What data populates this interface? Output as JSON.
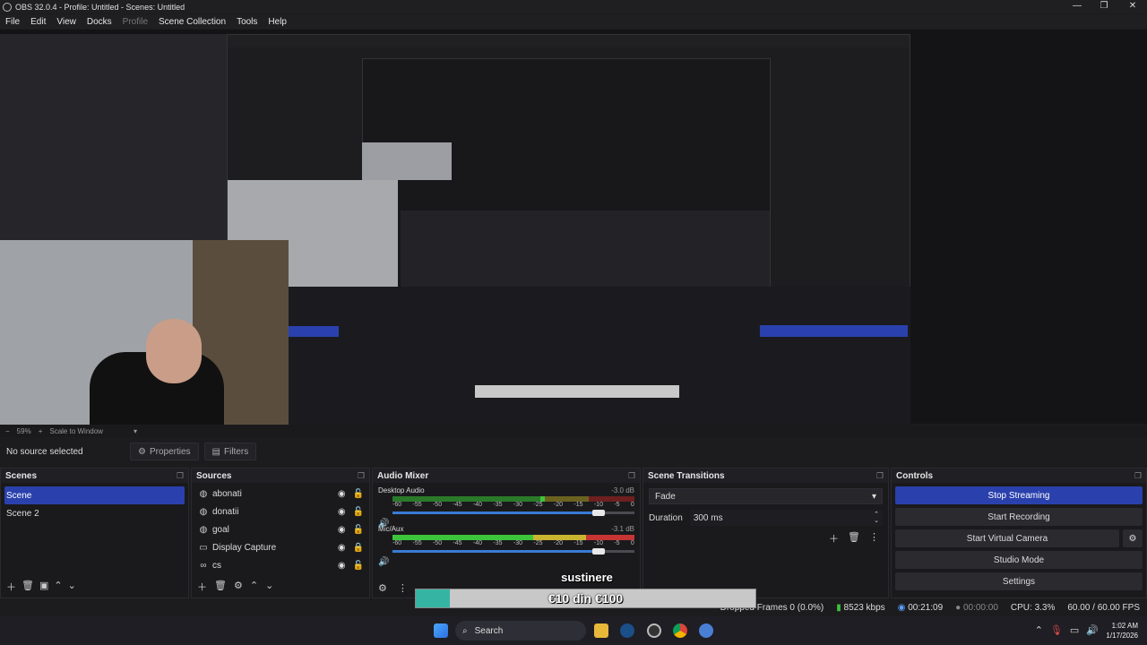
{
  "window": {
    "title": "OBS 32.0.4 - Profile: Untitled - Scenes: Untitled",
    "controls": [
      "—",
      "❐",
      "✕"
    ]
  },
  "menu": [
    "File",
    "Edit",
    "View",
    "Docks",
    "Profile",
    "Scene Collection",
    "Tools",
    "Help"
  ],
  "zoom": {
    "minus": "−",
    "value": "59%",
    "plus": "+",
    "mode": "Scale to Window"
  },
  "properties_bar": {
    "no_source": "No source selected",
    "properties": "Properties",
    "filters": "Filters"
  },
  "scenes": {
    "title": "Scenes",
    "items": [
      {
        "label": "Scene",
        "selected": true
      },
      {
        "label": "Scene 2",
        "selected": false
      }
    ]
  },
  "sources": {
    "title": "Sources",
    "items": [
      {
        "label": "abonati",
        "icon": "globe-icon",
        "locked": false
      },
      {
        "label": "donatii",
        "icon": "globe-icon",
        "locked": false
      },
      {
        "label": "goal",
        "icon": "globe-icon",
        "locked": false
      },
      {
        "label": "Display Capture",
        "icon": "monitor-icon",
        "locked": true
      },
      {
        "label": "cs",
        "icon": "link-icon",
        "locked": false
      }
    ]
  },
  "audio_mixer": {
    "title": "Audio Mixer",
    "channels": [
      {
        "name": "Desktop Audio",
        "db": "-3.0 dB",
        "volume_fraction": 0.85
      },
      {
        "name": "Mic/Aux",
        "db": "-3.1 dB",
        "volume_fraction": 0.85
      }
    ],
    "ticks": [
      "-60",
      "-55",
      "-50",
      "-45",
      "-40",
      "-35",
      "-30",
      "-25",
      "-20",
      "-15",
      "-10",
      "-5",
      "0"
    ]
  },
  "transitions": {
    "title": "Scene Transitions",
    "selected": "Fade",
    "duration_label": "Duration",
    "duration": "300 ms"
  },
  "controls": {
    "title": "Controls",
    "buttons": [
      "Stop Streaming",
      "Start Recording",
      "Start Virtual Camera",
      "Studio Mode",
      "Settings"
    ]
  },
  "overlay": {
    "label": "sustinere",
    "goal": "€10 din €100",
    "goal_fraction": 0.1
  },
  "status": {
    "dropped": "Dropped Frames 0 (0.0%)",
    "bitrate": "8523 kbps",
    "stream_time": "00:21:09",
    "rec_time": "00:00:00",
    "cpu": "CPU: 3.3%",
    "fps": "60.00 / 60.00 FPS"
  },
  "taskbar": {
    "search": "Search",
    "time": "1:02 AM",
    "date": "1/17/2026"
  },
  "colors": {
    "accent": "#2a41ad",
    "meter_green": "#3cc43c",
    "meter_yellow": "#c9b530",
    "meter_red": "#c63434",
    "goal_fill": "#35b4a4"
  }
}
